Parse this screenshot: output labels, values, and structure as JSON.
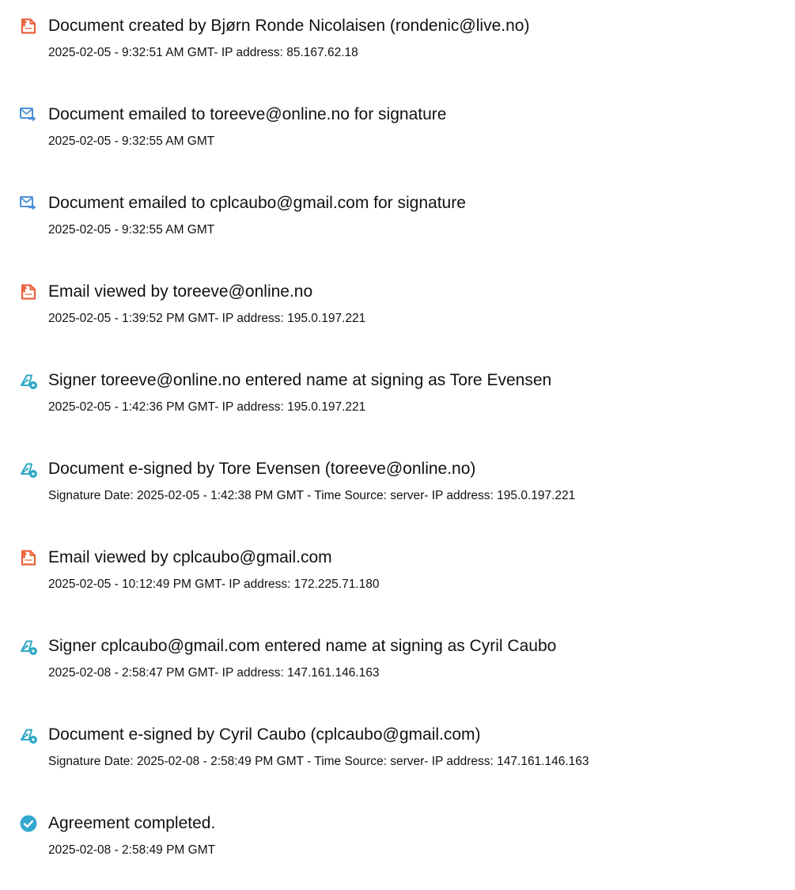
{
  "entries": [
    {
      "icon": "document-icon",
      "title": "Document created by Bjørn Ronde Nicolaisen (rondenic@live.no)",
      "detail": "2025-02-05 - 9:32:51 AM GMT- IP address: 85.167.62.18"
    },
    {
      "icon": "email-icon",
      "title": "Document emailed to toreeve@online.no for signature",
      "detail": "2025-02-05 - 9:32:55 AM GMT"
    },
    {
      "icon": "email-icon",
      "title": "Document emailed to cplcaubo@gmail.com for signature",
      "detail": "2025-02-05 - 9:32:55 AM GMT"
    },
    {
      "icon": "document-icon",
      "title": "Email viewed by toreeve@online.no",
      "detail": "2025-02-05 - 1:39:52 PM GMT- IP address: 195.0.197.221"
    },
    {
      "icon": "pen-icon",
      "title": "Signer toreeve@online.no entered name at signing as Tore Evensen",
      "detail": "2025-02-05 - 1:42:36 PM GMT- IP address: 195.0.197.221"
    },
    {
      "icon": "pen-icon",
      "title": "Document e-signed by Tore Evensen (toreeve@online.no)",
      "detail": "Signature Date: 2025-02-05 - 1:42:38 PM GMT - Time Source: server- IP address: 195.0.197.221"
    },
    {
      "icon": "document-icon",
      "title": "Email viewed by cplcaubo@gmail.com",
      "detail": "2025-02-05 - 10:12:49 PM GMT- IP address: 172.225.71.180"
    },
    {
      "icon": "pen-icon",
      "title": "Signer cplcaubo@gmail.com entered name at signing as Cyril Caubo",
      "detail": "2025-02-08 - 2:58:47 PM GMT- IP address: 147.161.146.163"
    },
    {
      "icon": "pen-icon",
      "title": "Document e-signed by Cyril Caubo (cplcaubo@gmail.com)",
      "detail": "Signature Date: 2025-02-08 - 2:58:49 PM GMT - Time Source: server- IP address: 147.161.146.163"
    },
    {
      "icon": "check-circle-icon",
      "title": "Agreement completed.",
      "detail": "2025-02-08 - 2:58:49 PM GMT"
    }
  ],
  "colors": {
    "document_icon": "#E8613A",
    "email_icon": "#4A90D9",
    "pen_icon": "#2EA9C6",
    "check_icon": "#33A8CF",
    "text": "#111111"
  }
}
